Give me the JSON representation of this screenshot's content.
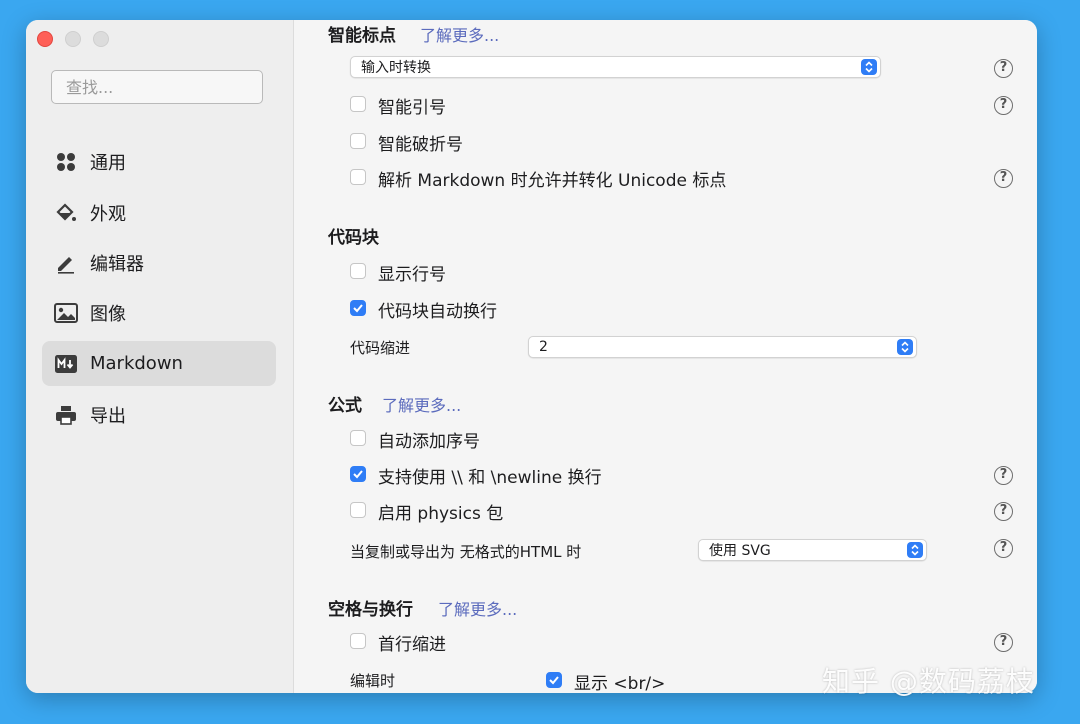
{
  "sidebar": {
    "search_placeholder": "查找...",
    "items": [
      {
        "label": "通用",
        "icon": "grid-icon"
      },
      {
        "label": "外观",
        "icon": "paint-bucket-icon"
      },
      {
        "label": "编辑器",
        "icon": "pencil-icon"
      },
      {
        "label": "图像",
        "icon": "image-icon"
      },
      {
        "label": "Markdown",
        "icon": "markdown-icon",
        "active": true
      },
      {
        "label": "导出",
        "icon": "printer-icon"
      }
    ]
  },
  "smart_punct": {
    "title": "智能标点",
    "learn_more": "了解更多...",
    "mode_select": "输入时转换",
    "smart_quotes": {
      "label": "智能引号",
      "checked": false
    },
    "smart_dashes": {
      "label": "智能破折号",
      "checked": false
    },
    "unicode_punct": {
      "label": "解析 Markdown 时允许并转化 Unicode 标点",
      "checked": false
    }
  },
  "code_block": {
    "title": "代码块",
    "line_numbers": {
      "label": "显示行号",
      "checked": false
    },
    "auto_wrap": {
      "label": "代码块自动换行",
      "checked": true
    },
    "indent_label": "代码缩进",
    "indent_value": "2"
  },
  "math": {
    "title": "公式",
    "learn_more": "了解更多...",
    "auto_number": {
      "label": "自动添加序号",
      "checked": false
    },
    "newline": {
      "label": "支持使用 \\\\ 和 \\newline 换行",
      "checked": true
    },
    "physics": {
      "label": "启用 physics 包",
      "checked": false
    },
    "export_label": "当复制或导出为 无格式的HTML 时",
    "export_value": "使用 SVG"
  },
  "whitespace": {
    "title": "空格与换行",
    "learn_more": "了解更多...",
    "first_indent": {
      "label": "首行缩进",
      "checked": false
    },
    "editing_label": "编辑时",
    "show_br": {
      "label": "显示 <br/>",
      "checked": true
    }
  },
  "help_glyph": "?",
  "watermark": "知乎 @数码荔枝"
}
